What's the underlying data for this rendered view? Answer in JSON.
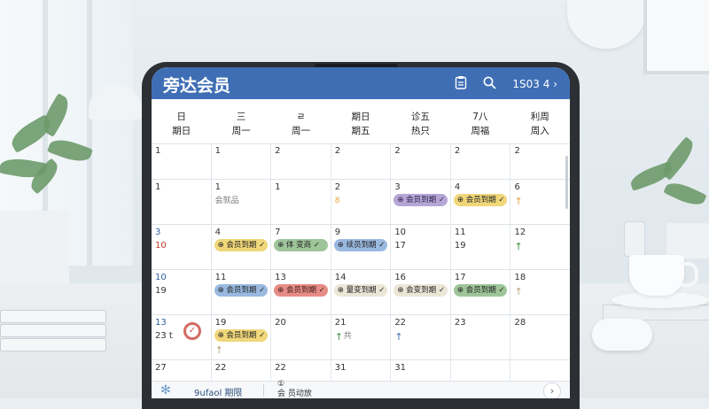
{
  "app": {
    "title": "旁达会员",
    "header_code": "1S03 4",
    "header_chevron": "›"
  },
  "weekdays": [
    {
      "top": "日",
      "bottom": "期日"
    },
    {
      "top": "三",
      "bottom": "周一"
    },
    {
      "top": "ㄹ",
      "bottom": "周一"
    },
    {
      "top": "期日",
      "bottom": "期五"
    },
    {
      "top": "诊五",
      "bottom": "热只"
    },
    {
      "top": "7八",
      "bottom": "周福"
    },
    {
      "top": "利周",
      "bottom": "周入"
    }
  ],
  "rows": [
    {
      "cells": [
        {
          "num": "1"
        },
        {
          "num": "1"
        },
        {
          "num": "2"
        },
        {
          "num": "2"
        },
        {
          "num": "2"
        },
        {
          "num": "2"
        },
        {
          "num": "2"
        }
      ]
    },
    {
      "cells": [
        {
          "num": "1"
        },
        {
          "num": "1",
          "sub": "会就品"
        },
        {
          "num": "1"
        },
        {
          "num": "2",
          "sub": "8"
        },
        {
          "num": "3",
          "pill": {
            "label": "会员到期",
            "color": "purple"
          }
        },
        {
          "num": "4",
          "pill": {
            "label": "会员到期",
            "color": "yellow"
          }
        },
        {
          "num": "6",
          "arrow": {
            "glyph": "↑",
            "color": "orange"
          }
        }
      ]
    },
    {
      "cells": [
        {
          "num": "3",
          "num2": "10"
        },
        {
          "num": "4",
          "pill": {
            "label": "会员到期",
            "color": "yellow"
          }
        },
        {
          "num": "7",
          "pill": {
            "label": "体 变商",
            "color": "green"
          }
        },
        {
          "num": "9",
          "pill": {
            "label": "续员到期",
            "color": "blue"
          }
        },
        {
          "num": "10",
          "num2": "17"
        },
        {
          "num": "11",
          "num2": "19"
        },
        {
          "num": "12",
          "arrow": {
            "glyph": "↑",
            "color": "green"
          }
        }
      ]
    },
    {
      "cells": [
        {
          "num": "10",
          "num2": "19"
        },
        {
          "num": "11",
          "pill": {
            "label": "会员到期",
            "color": "blue"
          }
        },
        {
          "num": "13",
          "pill": {
            "label": "会员到期",
            "color": "red"
          }
        },
        {
          "num": "14",
          "pill": {
            "label": "量变到期",
            "color": "beige"
          }
        },
        {
          "num": "16",
          "pill": {
            "label": "会变到期",
            "color": "beige"
          }
        },
        {
          "num": "17",
          "pill": {
            "label": "会员到期",
            "color": "green"
          }
        },
        {
          "num": "18",
          "arrow": {
            "glyph": "↑",
            "color": "tan"
          }
        }
      ]
    },
    {
      "cells": [
        {
          "num": "13",
          "num2": "23 t",
          "check": "✓"
        },
        {
          "num": "19",
          "pill": {
            "label": "会员到期",
            "color": "yellow"
          },
          "arrow": {
            "glyph": "↑",
            "color": "tan"
          }
        },
        {
          "num": "20"
        },
        {
          "num": "21",
          "arrow": {
            "glyph": "↑",
            "color": "green"
          },
          "arrow_text": "共"
        },
        {
          "num": "22",
          "arrow": {
            "glyph": "↑",
            "color": "blue"
          }
        },
        {
          "num": "23"
        },
        {
          "num": "28"
        }
      ]
    },
    {
      "cells": [
        {
          "num": "27"
        },
        {
          "num": "22"
        },
        {
          "num": "22"
        },
        {
          "num": "31"
        },
        {
          "num": "31"
        },
        {
          "num": ""
        },
        {
          "num": ""
        }
      ]
    }
  ],
  "bottom_bar": {
    "logo": "✻",
    "text": "9ufaol 期限",
    "text2_line1": "①",
    "text2_line2": "会 员动放",
    "arrow": "›"
  }
}
